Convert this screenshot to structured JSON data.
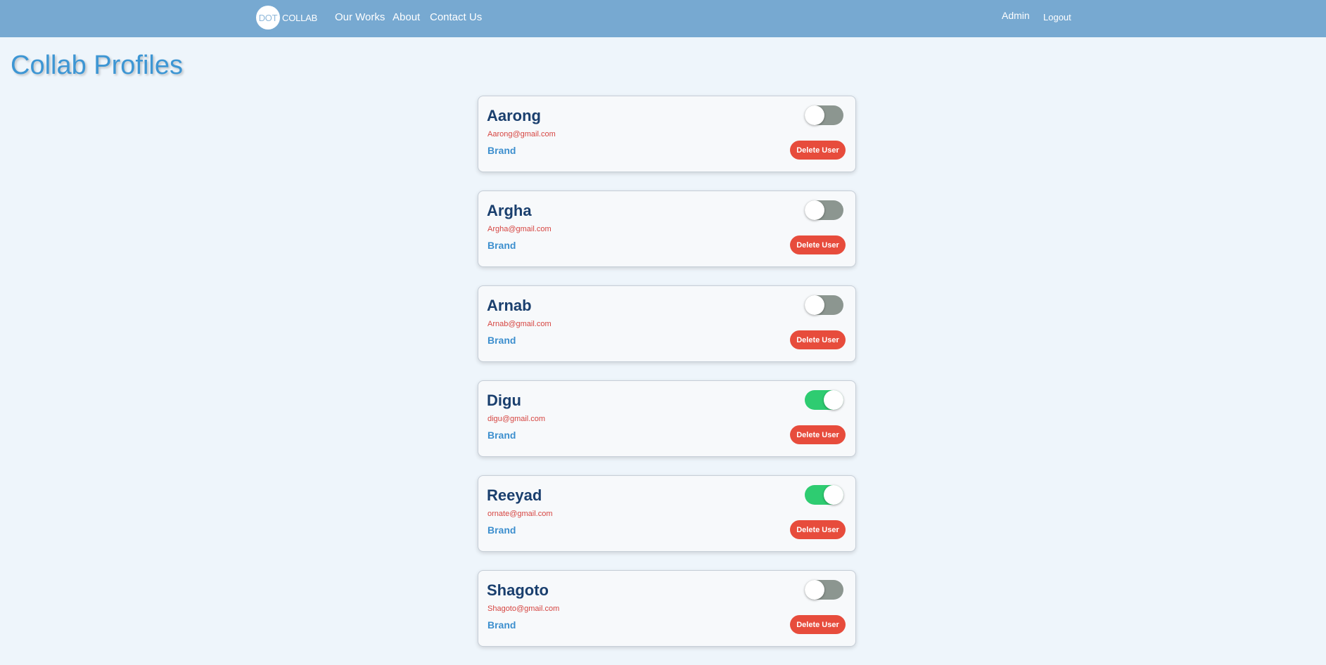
{
  "nav": {
    "logo_circle_text": "DOT",
    "logo_text": "COLLAB",
    "links": [
      "Our Works",
      "About",
      "Contact Us"
    ],
    "admin_label": "Admin",
    "logout_label": "Logout"
  },
  "page": {
    "title": "Collab Profiles"
  },
  "profiles": [
    {
      "name": "Aarong",
      "email": "Aarong@gmail.com",
      "role": "Brand",
      "active": false,
      "delete_label": "Delete User"
    },
    {
      "name": "Argha",
      "email": "Argha@gmail.com",
      "role": "Brand",
      "active": false,
      "delete_label": "Delete User"
    },
    {
      "name": "Arnab",
      "email": "Arnab@gmail.com",
      "role": "Brand",
      "active": false,
      "delete_label": "Delete User"
    },
    {
      "name": "Digu",
      "email": "digu@gmail.com",
      "role": "Brand",
      "active": true,
      "delete_label": "Delete User"
    },
    {
      "name": "Reeyad",
      "email": "ornate@gmail.com",
      "role": "Brand",
      "active": true,
      "delete_label": "Delete User"
    },
    {
      "name": "Shagoto",
      "email": "Shagoto@gmail.com",
      "role": "Brand",
      "active": false,
      "delete_label": "Delete User"
    }
  ],
  "colors": {
    "navbar": "#77a9d1",
    "background": "#eef5fb",
    "title": "#3d96d4",
    "toggle_on": "#2ecc71",
    "toggle_off": "#8c9690",
    "delete_button": "#e74c3c"
  }
}
